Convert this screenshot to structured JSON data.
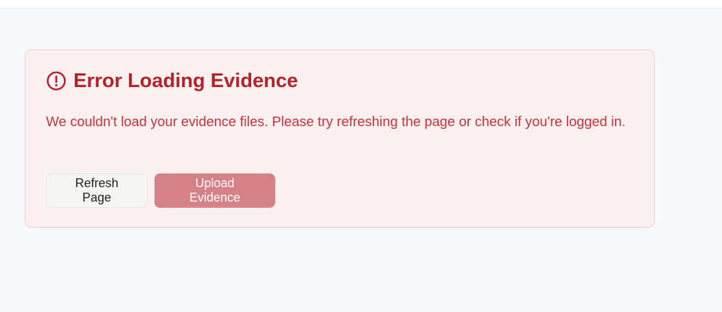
{
  "colors": {
    "error_red": "#b3232c",
    "error_text": "#c7333d",
    "card_bg": "#fdf0f1",
    "card_border": "#f3c9cd",
    "upload_button_bg": "#d58185",
    "refresh_button_bg": "#f5f5f3"
  },
  "error": {
    "icon": "alert-circle-icon",
    "title": "Error Loading Evidence",
    "message": "We couldn't load your evidence files. Please try refreshing the page or check if you're logged in."
  },
  "actions": {
    "refresh_label": "Refresh Page",
    "upload_label": "Upload Evidence"
  }
}
